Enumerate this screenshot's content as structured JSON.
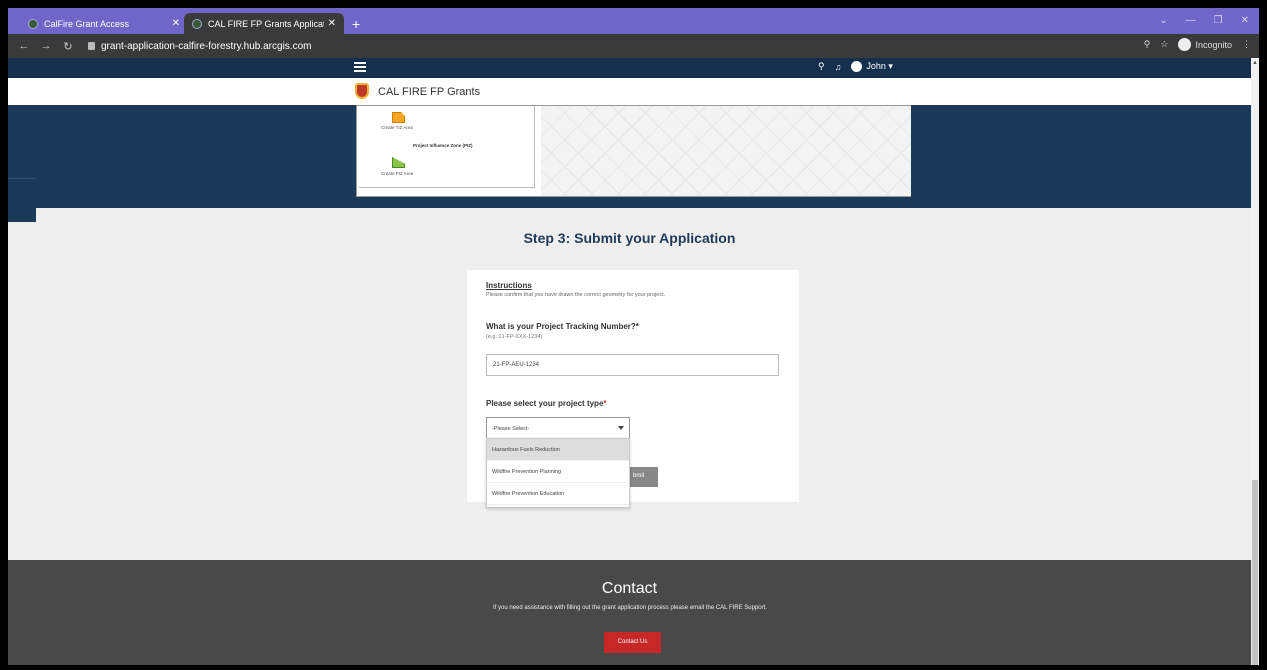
{
  "browser": {
    "tabs": [
      {
        "title": "CalFire Grant Access"
      },
      {
        "title": "CAL FIRE FP Grants Application"
      }
    ],
    "url": "grant-application-calfire-forestry.hub.arcgis.com",
    "profile_label": "Incognito"
  },
  "site": {
    "title": "CAL FIRE FP Grants",
    "user_name": "John ▾"
  },
  "map_panel": {
    "create_label_1": "Create TIZ Area",
    "section_label": "Project Influence Zone (PIZ)",
    "create_label_2": "Create PIZ Area"
  },
  "step_heading": "Step 3: Submit your Application",
  "form": {
    "instructions_heading": "Instructions",
    "instructions_text": "Please confirm that you have drawn the correct geometry for your project.",
    "tracking_question": "What is your Project Tracking Number?*",
    "tracking_hint": "(e.g. 21-FP-XXX-1234)",
    "tracking_value": "21-FP-AEU-1234",
    "type_question": "Please select your project type",
    "type_required_mark": "*",
    "type_selected": "-Please Select-",
    "type_options": [
      "Hazardous Fuels Reduction",
      "Wildfire Prevention Planning",
      "Wildfire Prevention Education"
    ],
    "submit_label": "bmit"
  },
  "footer": {
    "title": "Contact",
    "text": "If you need assistance with filling out the grant application process please email the CAL FIRE Support.",
    "button_label": "Contact Us"
  },
  "colors": {
    "titlebar": "#7066c9",
    "header_dark": "#15304f",
    "band": "#1b3a59",
    "footer": "#494949",
    "accent_red": "#c62828"
  }
}
